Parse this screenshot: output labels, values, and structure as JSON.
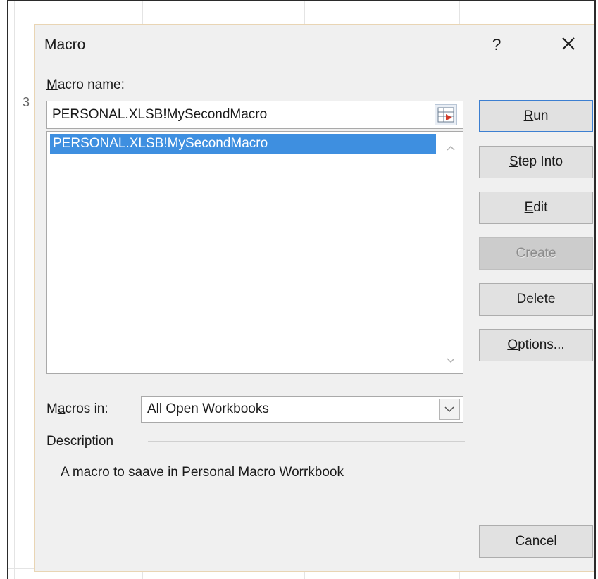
{
  "dialog": {
    "title": "Macro",
    "help_label": "?",
    "close_icon": "close-icon"
  },
  "background": {
    "row_hint": "3"
  },
  "macro_name": {
    "label_prefix": "",
    "label_accel": "M",
    "label_rest": "acro name:",
    "value": "PERSONAL.XLSB!MySecondMacro",
    "ref_icon": "collapse-dialog-icon"
  },
  "macro_list": {
    "items": [
      "PERSONAL.XLSB!MySecondMacro"
    ],
    "selected_index": 0,
    "scroll_up_icon": "chevron-up-icon",
    "scroll_down_icon": "chevron-down-icon"
  },
  "macros_in": {
    "label_prefix": "M",
    "label_accel": "a",
    "label_rest": "cros in:",
    "selected": "All Open Workbooks",
    "dropdown_icon": "chevron-down-icon"
  },
  "description": {
    "label": "Description",
    "text": "A macro to saave in Personal Macro Worrkbook"
  },
  "buttons": {
    "run": {
      "prefix": "",
      "accel": "R",
      "rest": "un"
    },
    "step_into": {
      "prefix": "",
      "accel": "S",
      "rest": "tep Into"
    },
    "edit": {
      "prefix": "",
      "accel": "E",
      "rest": "dit"
    },
    "create": {
      "prefix": "",
      "accel": "",
      "rest": "Create"
    },
    "delete": {
      "prefix": "",
      "accel": "D",
      "rest": "elete"
    },
    "options": {
      "prefix": "",
      "accel": "O",
      "rest": "ptions..."
    },
    "cancel": {
      "prefix": "",
      "accel": "",
      "rest": "Cancel"
    }
  },
  "colors": {
    "selection": "#3e8fe0",
    "dialog_bg": "#f0f0f0",
    "default_button_border": "#3c7fd1"
  }
}
